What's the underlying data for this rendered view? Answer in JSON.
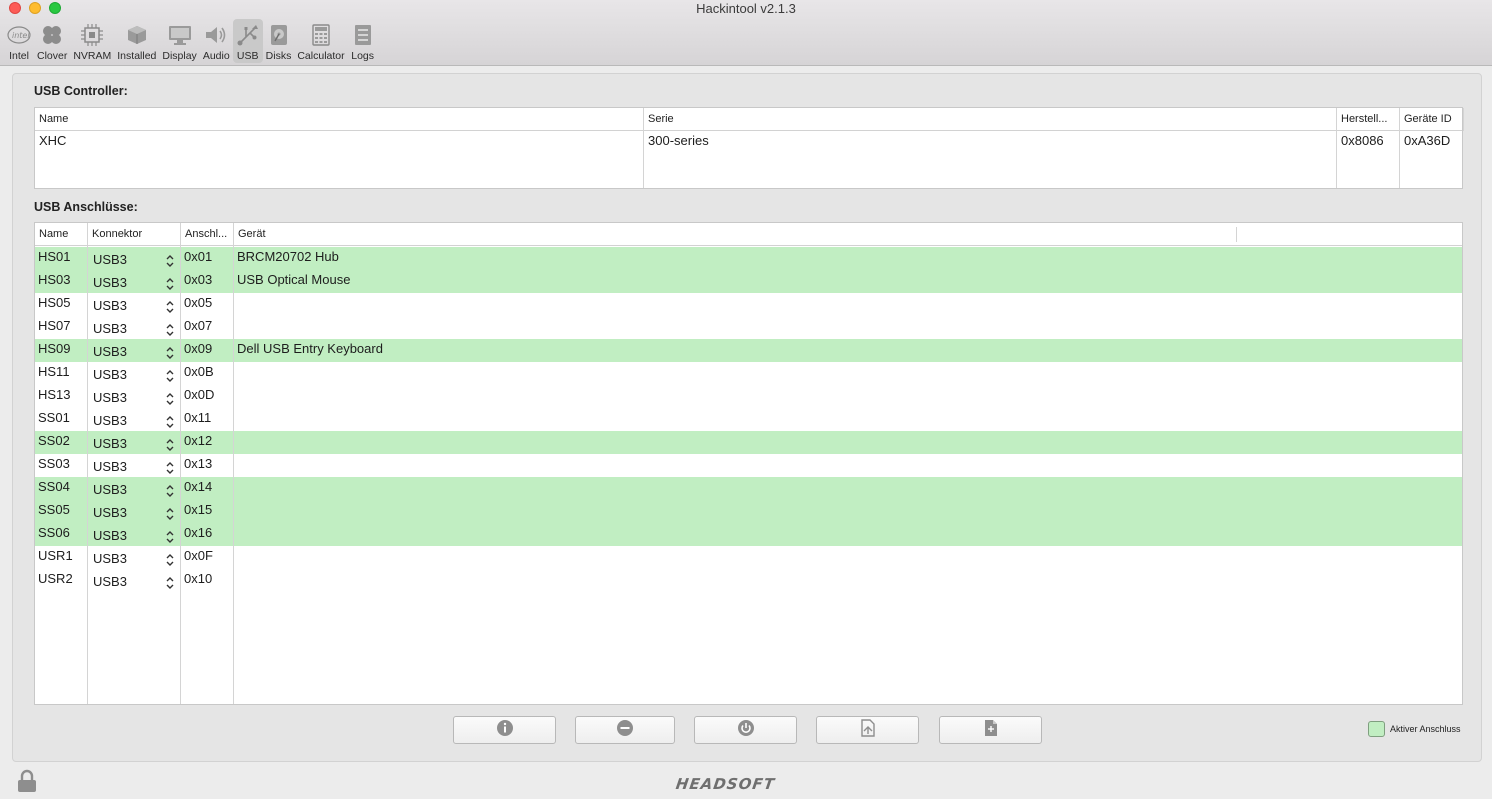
{
  "window": {
    "title": "Hackintool v2.1.3"
  },
  "toolbar": {
    "items": [
      {
        "label": "Intel",
        "icon": "intel-icon"
      },
      {
        "label": "Clover",
        "icon": "clover-icon"
      },
      {
        "label": "NVRAM",
        "icon": "chip-icon"
      },
      {
        "label": "Installed",
        "icon": "package-icon"
      },
      {
        "label": "Display",
        "icon": "display-icon"
      },
      {
        "label": "Audio",
        "icon": "speaker-icon"
      },
      {
        "label": "USB",
        "icon": "usb-icon",
        "active": true
      },
      {
        "label": "Disks",
        "icon": "disk-icon"
      },
      {
        "label": "Calculator",
        "icon": "calculator-icon"
      },
      {
        "label": "Logs",
        "icon": "logs-icon"
      }
    ]
  },
  "controller": {
    "title": "USB Controller:",
    "columns": {
      "name": "Name",
      "serie": "Serie",
      "vendor": "Herstell...",
      "device_id": "Geräte ID"
    },
    "row": {
      "name": "XHC",
      "serie": "300-series",
      "vendor": "0x8086",
      "device_id": "0xA36D"
    }
  },
  "ports": {
    "title": "USB Anschlüsse:",
    "columns": {
      "name": "Name",
      "connector": "Konnektor",
      "port": "Anschl...",
      "device": "Gerät"
    },
    "rows": [
      {
        "name": "HS01",
        "connector": "USB3",
        "port": "0x01",
        "device": "BRCM20702 Hub",
        "active": true
      },
      {
        "name": "HS03",
        "connector": "USB3",
        "port": "0x03",
        "device": "USB Optical Mouse",
        "active": true
      },
      {
        "name": "HS05",
        "connector": "USB3",
        "port": "0x05",
        "device": "",
        "active": false
      },
      {
        "name": "HS07",
        "connector": "USB3",
        "port": "0x07",
        "device": "",
        "active": false
      },
      {
        "name": "HS09",
        "connector": "USB3",
        "port": "0x09",
        "device": "Dell USB Entry Keyboard",
        "active": true
      },
      {
        "name": "HS11",
        "connector": "USB3",
        "port": "0x0B",
        "device": "",
        "active": false
      },
      {
        "name": "HS13",
        "connector": "USB3",
        "port": "0x0D",
        "device": "",
        "active": false
      },
      {
        "name": "SS01",
        "connector": "USB3",
        "port": "0x11",
        "device": "",
        "active": false
      },
      {
        "name": "SS02",
        "connector": "USB3",
        "port": "0x12",
        "device": "",
        "active": true
      },
      {
        "name": "SS03",
        "connector": "USB3",
        "port": "0x13",
        "device": "",
        "active": false
      },
      {
        "name": "SS04",
        "connector": "USB3",
        "port": "0x14",
        "device": "",
        "active": true
      },
      {
        "name": "SS05",
        "connector": "USB3",
        "port": "0x15",
        "device": "",
        "active": true
      },
      {
        "name": "SS06",
        "connector": "USB3",
        "port": "0x16",
        "device": "",
        "active": true
      },
      {
        "name": "USR1",
        "connector": "USB3",
        "port": "0x0F",
        "device": "",
        "active": false
      },
      {
        "name": "USR2",
        "connector": "USB3",
        "port": "0x10",
        "device": "",
        "active": false
      }
    ]
  },
  "buttons": [
    {
      "name": "info-button",
      "icon": "info-icon"
    },
    {
      "name": "remove-button",
      "icon": "minus-circle-icon"
    },
    {
      "name": "refresh-button",
      "icon": "power-refresh-icon"
    },
    {
      "name": "export-button",
      "icon": "export-file-icon"
    },
    {
      "name": "inject-button",
      "icon": "inject-file-icon"
    }
  ],
  "legend": {
    "label": "Aktiver Anschluss",
    "color": "#c1eec2"
  },
  "footer": {
    "brand": "HEADSOFT"
  },
  "colors": {
    "active_row": "#c1eec2"
  }
}
